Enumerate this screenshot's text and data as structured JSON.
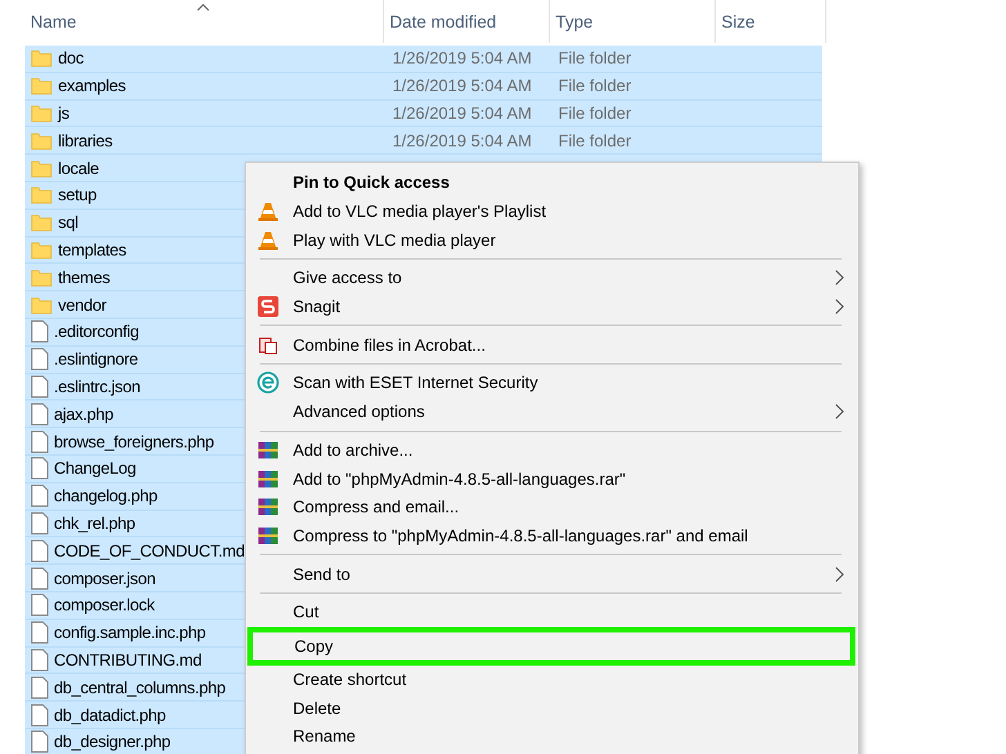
{
  "columns": [
    {
      "label": "Name",
      "sorted": true
    },
    {
      "label": "Date modified",
      "sorted": false
    },
    {
      "label": "Type",
      "sorted": false
    },
    {
      "label": "Size",
      "sorted": false
    }
  ],
  "rows": [
    {
      "name": "doc",
      "kind": "folder",
      "selected": true,
      "date": "1/26/2019 5:04 AM",
      "type": "File folder"
    },
    {
      "name": "examples",
      "kind": "folder",
      "selected": true,
      "date": "1/26/2019 5:04 AM",
      "type": "File folder"
    },
    {
      "name": "js",
      "kind": "folder",
      "selected": true,
      "date": "1/26/2019 5:04 AM",
      "type": "File folder"
    },
    {
      "name": "libraries",
      "kind": "folder",
      "selected": true,
      "date": "1/26/2019 5:04 AM",
      "type": "File folder"
    },
    {
      "name": "locale",
      "kind": "folder",
      "selected": true
    },
    {
      "name": "setup",
      "kind": "folder",
      "selected": true
    },
    {
      "name": "sql",
      "kind": "folder",
      "selected": true
    },
    {
      "name": "templates",
      "kind": "folder",
      "selected": true
    },
    {
      "name": "themes",
      "kind": "folder",
      "selected": true
    },
    {
      "name": "vendor",
      "kind": "folder",
      "selected": true
    },
    {
      "name": ".editorconfig",
      "kind": "file",
      "selected": true
    },
    {
      "name": ".eslintignore",
      "kind": "file",
      "selected": true
    },
    {
      "name": ".eslintrc.json",
      "kind": "file",
      "selected": true
    },
    {
      "name": "ajax.php",
      "kind": "file",
      "selected": true
    },
    {
      "name": "browse_foreigners.php",
      "kind": "file",
      "selected": true
    },
    {
      "name": "ChangeLog",
      "kind": "file",
      "selected": true
    },
    {
      "name": "changelog.php",
      "kind": "file",
      "selected": true
    },
    {
      "name": "chk_rel.php",
      "kind": "file",
      "selected": true
    },
    {
      "name": "CODE_OF_CONDUCT.md",
      "kind": "file",
      "selected": true
    },
    {
      "name": "composer.json",
      "kind": "file",
      "selected": true
    },
    {
      "name": "composer.lock",
      "kind": "file",
      "selected": true
    },
    {
      "name": "config.sample.inc.php",
      "kind": "file",
      "selected": true
    },
    {
      "name": "CONTRIBUTING.md",
      "kind": "file",
      "selected": true
    },
    {
      "name": "db_central_columns.php",
      "kind": "file",
      "selected": true
    },
    {
      "name": "db_datadict.php",
      "kind": "file",
      "selected": true
    },
    {
      "name": "db_designer.php",
      "kind": "file",
      "selected": true
    }
  ],
  "context_menu": {
    "groups": [
      [
        {
          "label": "Pin to Quick access",
          "kind": "plain",
          "default": true,
          "submenu": false,
          "highlighted": false
        },
        {
          "label": "Add to VLC media player's Playlist",
          "kind": "vlc",
          "default": false,
          "submenu": false,
          "highlighted": false
        },
        {
          "label": "Play with VLC media player",
          "kind": "vlc",
          "default": false,
          "submenu": false,
          "highlighted": false
        }
      ],
      [
        {
          "label": "Give access to",
          "kind": "plain",
          "default": false,
          "submenu": true,
          "highlighted": false
        },
        {
          "label": "Snagit",
          "kind": "snagit",
          "default": false,
          "submenu": true,
          "highlighted": false
        }
      ],
      [
        {
          "label": "Combine files in Acrobat...",
          "kind": "acrobat",
          "default": false,
          "submenu": false,
          "highlighted": false
        }
      ],
      [
        {
          "label": "Scan with ESET Internet Security",
          "kind": "eset",
          "default": false,
          "submenu": false,
          "highlighted": false
        },
        {
          "label": "Advanced options",
          "kind": "plain",
          "default": false,
          "submenu": true,
          "highlighted": false
        }
      ],
      [
        {
          "label": "Add to archive...",
          "kind": "archive",
          "default": false,
          "submenu": false,
          "highlighted": false
        },
        {
          "label": "Add to \"phpMyAdmin-4.8.5-all-languages.rar\"",
          "kind": "archive",
          "default": false,
          "submenu": false,
          "highlighted": false
        },
        {
          "label": "Compress and email...",
          "kind": "archive",
          "default": false,
          "submenu": false,
          "highlighted": false
        },
        {
          "label": "Compress to \"phpMyAdmin-4.8.5-all-languages.rar\" and email",
          "kind": "archive",
          "default": false,
          "submenu": false,
          "highlighted": false
        }
      ],
      [
        {
          "label": "Send to",
          "kind": "plain",
          "default": false,
          "submenu": true,
          "highlighted": false
        }
      ],
      [
        {
          "label": "Cut",
          "kind": "plain",
          "default": false,
          "submenu": false,
          "highlighted": false
        },
        {
          "label": "Copy",
          "kind": "plain",
          "default": false,
          "submenu": false,
          "highlighted": true
        },
        {
          "label": "Create shortcut",
          "kind": "plain",
          "default": false,
          "submenu": false,
          "highlighted": false
        },
        {
          "label": "Delete",
          "kind": "plain",
          "default": false,
          "submenu": false,
          "highlighted": false
        },
        {
          "label": "Rename",
          "kind": "plain",
          "default": false,
          "submenu": false,
          "highlighted": false
        }
      ]
    ]
  }
}
